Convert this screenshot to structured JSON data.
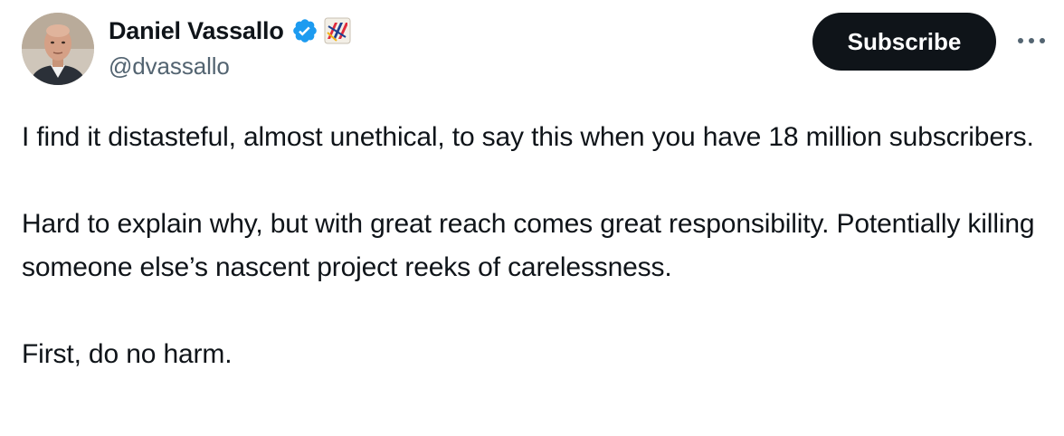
{
  "author": {
    "display_name": "Daniel Vassallo",
    "handle": "@dvassallo",
    "verified_icon": "verified-badge-icon",
    "affiliation_icon": "affiliate-logo-icon"
  },
  "actions": {
    "subscribe_label": "Subscribe",
    "more_icon": "more-horizontal-icon"
  },
  "tweet": {
    "paragraphs": [
      "I find it distasteful, almost unethical, to say this when you have 18 million subscribers.",
      "Hard to explain why, but with great reach comes great responsibility. Potentially killing someone else’s nascent project reeks of carelessness.",
      "First, do no harm."
    ]
  },
  "colors": {
    "text": "#0f1419",
    "secondary": "#536471",
    "verified_blue": "#1d9bf0",
    "button_bg": "#0f1419"
  }
}
